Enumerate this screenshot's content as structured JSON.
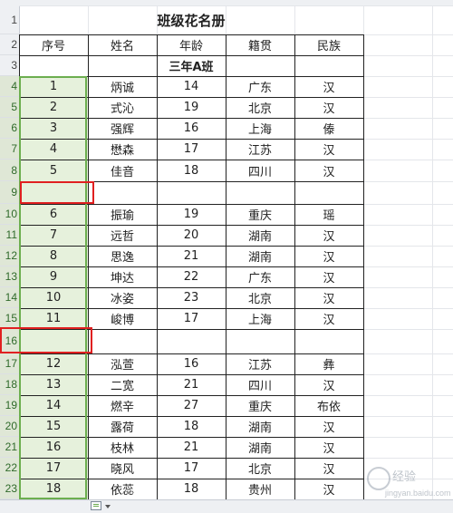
{
  "sheet": {
    "title": "班级花名册",
    "headers": [
      "序号",
      "姓名",
      "年龄",
      "籍贯",
      "民族"
    ],
    "section": "三年A班",
    "row_numbers": [
      "1",
      "2",
      "3",
      "4",
      "5",
      "6",
      "7",
      "8",
      "9",
      "10",
      "11",
      "12",
      "13",
      "14",
      "15",
      "16",
      "17",
      "18",
      "19",
      "20",
      "21",
      "22",
      "23"
    ],
    "rows": [
      {
        "type": "data",
        "cells": [
          "1",
          "炳诚",
          "14",
          "广东",
          "汉"
        ]
      },
      {
        "type": "data",
        "cells": [
          "2",
          "式沁",
          "19",
          "北京",
          "汉"
        ]
      },
      {
        "type": "data",
        "cells": [
          "3",
          "强辉",
          "16",
          "上海",
          "傣"
        ]
      },
      {
        "type": "data",
        "cells": [
          "4",
          "懋森",
          "17",
          "江苏",
          "汉"
        ]
      },
      {
        "type": "data",
        "cells": [
          "5",
          "佳音",
          "18",
          "四川",
          "汉"
        ]
      },
      {
        "type": "blank",
        "cells": [
          "",
          "",
          "",
          "",
          ""
        ]
      },
      {
        "type": "data",
        "cells": [
          "6",
          "振瑜",
          "19",
          "重庆",
          "瑶"
        ]
      },
      {
        "type": "data",
        "cells": [
          "7",
          "远哲",
          "20",
          "湖南",
          "汉"
        ]
      },
      {
        "type": "data",
        "cells": [
          "8",
          "思逸",
          "21",
          "湖南",
          "汉"
        ]
      },
      {
        "type": "data",
        "cells": [
          "9",
          "坤达",
          "22",
          "广东",
          "汉"
        ]
      },
      {
        "type": "data",
        "cells": [
          "10",
          "冰姿",
          "23",
          "北京",
          "汉"
        ]
      },
      {
        "type": "data",
        "cells": [
          "11",
          "峻博",
          "17",
          "上海",
          "汉"
        ]
      },
      {
        "type": "blank",
        "cells": [
          "",
          "",
          "",
          "",
          ""
        ]
      },
      {
        "type": "data",
        "cells": [
          "12",
          "泓萱",
          "16",
          "江苏",
          "彝"
        ]
      },
      {
        "type": "data",
        "cells": [
          "13",
          "二宽",
          "21",
          "四川",
          "汉"
        ]
      },
      {
        "type": "data",
        "cells": [
          "14",
          "燃辛",
          "27",
          "重庆",
          "布依"
        ]
      },
      {
        "type": "data",
        "cells": [
          "15",
          "露荷",
          "18",
          "湖南",
          "汉"
        ]
      },
      {
        "type": "data",
        "cells": [
          "16",
          "枝林",
          "21",
          "湖南",
          "汉"
        ]
      },
      {
        "type": "data",
        "cells": [
          "17",
          "晓风",
          "17",
          "北京",
          "汉"
        ]
      },
      {
        "type": "data",
        "cells": [
          "18",
          "依蕊",
          "18",
          "贵州",
          "汉"
        ]
      }
    ]
  },
  "watermark": {
    "text": "经验",
    "url": "jingyan.baidu.com"
  },
  "colors": {
    "selection_border": "#6cae4f",
    "selection_fill": "#e6f1dc",
    "highlight_box": "#e02020"
  },
  "icons": {
    "paste_options": "clipboard-icon",
    "paste_dropdown": "chevron-down-icon"
  }
}
